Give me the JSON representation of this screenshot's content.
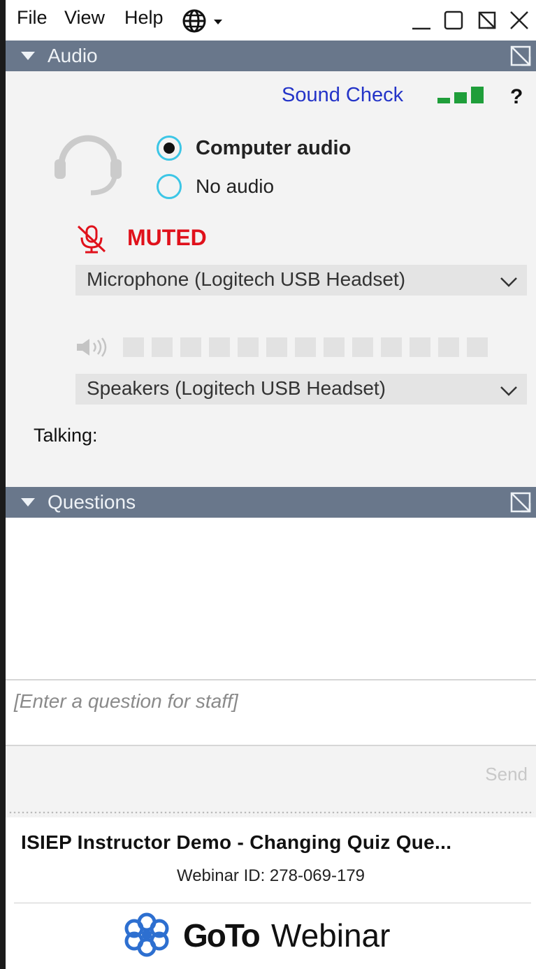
{
  "menu": {
    "file": "File",
    "view": "View",
    "help": "Help"
  },
  "icons": {
    "language": "globe-icon",
    "minimize": "minimize-icon",
    "maximize": "maximize-icon",
    "restore": "restore-icon",
    "close": "close-icon",
    "headset": "headset-icon",
    "mic_muted": "microphone-muted-icon",
    "speaker": "speaker-icon",
    "logo": "gotowebinar-logo-icon"
  },
  "audio": {
    "header": "Audio",
    "sound_check": "Sound Check",
    "help": "?",
    "options": {
      "computer": "Computer audio",
      "none": "No audio"
    },
    "selected_option": "Computer audio",
    "mute_status": "MUTED",
    "microphone": "Microphone (Logitech USB Headset)",
    "speakers": "Speakers (Logitech USB Headset)",
    "talking_label": "Talking:",
    "speaker_level": 0
  },
  "questions": {
    "header": "Questions",
    "placeholder": "[Enter a question for staff]",
    "send": "Send"
  },
  "footer": {
    "webinar_title": "ISIEP Instructor Demo - Changing Quiz Que...",
    "webinar_id": "Webinar ID: 278-069-179",
    "brand_goto": "GoTo",
    "brand_webinar": "Webinar"
  },
  "colors": {
    "header_bg": "#69778b",
    "link": "#2434c8",
    "muted": "#e0111b",
    "signal": "#1f9e3a",
    "radio_ring": "#3cc6e6",
    "logo": "#2d6fd0"
  }
}
